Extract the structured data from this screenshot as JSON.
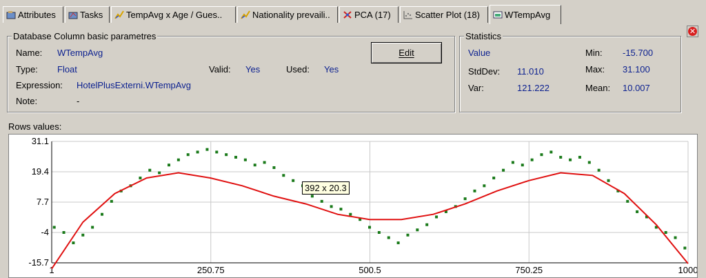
{
  "tabs": [
    {
      "label": "Attributes",
      "icon": "attributes-icon"
    },
    {
      "label": "Tasks",
      "icon": "tasks-icon"
    },
    {
      "label": "TempAvg x Age / Gues..",
      "icon": "chart-icon"
    },
    {
      "label": "Nationality prevaili..",
      "icon": "chart-icon"
    },
    {
      "label": "PCA (17)",
      "icon": "pca-icon"
    },
    {
      "label": "Scatter Plot (18)",
      "icon": "scatter-icon"
    },
    {
      "label": "WTempAvg",
      "icon": "column-icon"
    }
  ],
  "db_group": {
    "title": "Database Column basic parametres",
    "name_label": "Name:",
    "name_value": "WTempAvg",
    "type_label": "Type:",
    "type_value": "Float",
    "valid_label": "Valid:",
    "valid_value": "Yes",
    "used_label": "Used:",
    "used_value": "Yes",
    "expression_label": "Expression:",
    "expression_value": "HotelPlusExterni.WTempAvg",
    "note_label": "Note:",
    "note_value": "-",
    "edit_button": "Edit"
  },
  "stats_group": {
    "title": "Statistics",
    "value_label": "Value",
    "stddev_label": "StdDev:",
    "stddev_value": "11.010",
    "var_label": "Var:",
    "var_value": "121.222",
    "min_label": "Min:",
    "min_value": "-15.700",
    "max_label": "Max:",
    "max_value": "31.100",
    "mean_label": "Mean:",
    "mean_value": "10.007"
  },
  "rows_values_label": "Rows values:",
  "tooltip": "392 x 20.3",
  "colors": {
    "points": "#1a7a1a",
    "curve": "#e01010",
    "accent": "#0a1f8f",
    "grid": "#c8c8c8"
  },
  "chart_data": {
    "type": "scatter",
    "xlim": [
      1,
      1000
    ],
    "ylim": [
      -15.7,
      31.1
    ],
    "x_ticks": [
      "1",
      "250.75",
      "500.5",
      "750.25",
      "1000"
    ],
    "y_ticks": [
      "31.1",
      "19.4",
      "7.7",
      "-4",
      "-15.7"
    ],
    "grid": true,
    "series": [
      {
        "kind": "points",
        "x": [
          5,
          20,
          35,
          50,
          65,
          80,
          95,
          110,
          125,
          140,
          155,
          170,
          185,
          200,
          215,
          230,
          245,
          260,
          275,
          290,
          305,
          320,
          335,
          350,
          365,
          380,
          395,
          410,
          425,
          440,
          455,
          470,
          485,
          500,
          515,
          530,
          545,
          560,
          575,
          590,
          605,
          620,
          635,
          650,
          665,
          680,
          695,
          710,
          725,
          740,
          755,
          770,
          785,
          800,
          815,
          830,
          845,
          860,
          875,
          890,
          905,
          920,
          935,
          950,
          965,
          980,
          995
        ],
        "y": [
          -2,
          -4,
          -8,
          -5,
          -2,
          3,
          8,
          12,
          14,
          17,
          20,
          19,
          22,
          24,
          26,
          27,
          28,
          27,
          26,
          25,
          24,
          22,
          23,
          21,
          18,
          16,
          14,
          10,
          8,
          6,
          5,
          3,
          1,
          -2,
          -4,
          -6,
          -8,
          -5,
          -3,
          -1,
          2,
          4,
          6,
          9,
          12,
          14,
          17,
          20,
          23,
          22,
          24,
          26,
          27,
          25,
          24,
          25,
          23,
          20,
          16,
          12,
          8,
          4,
          2,
          -2,
          -4,
          -6,
          -10
        ]
      },
      {
        "kind": "trend",
        "x": [
          1,
          50,
          100,
          150,
          200,
          250,
          300,
          350,
          400,
          450,
          500,
          550,
          600,
          650,
          700,
          750,
          800,
          850,
          900,
          950,
          1000
        ],
        "y": [
          -18,
          0,
          11,
          17,
          19,
          17,
          14,
          10,
          7,
          3,
          1,
          1,
          3,
          7,
          12,
          16,
          19,
          18,
          11,
          -1,
          -16
        ]
      }
    ]
  }
}
